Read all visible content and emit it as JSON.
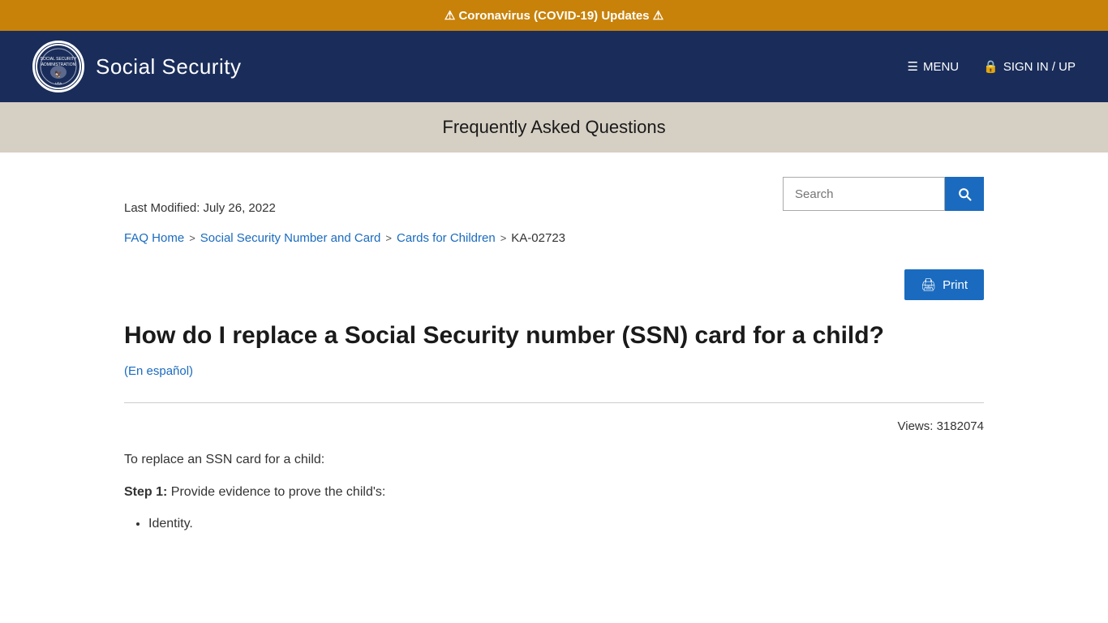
{
  "alert": {
    "text": "Coronavirus (COVID-19) Updates",
    "warning_symbol": "⚠"
  },
  "header": {
    "logo_alt": "Social Security Administration seal",
    "site_title": "Social Security",
    "nav": {
      "menu_label": "MENU",
      "signin_label": "SIGN IN / UP"
    }
  },
  "subtitle_bar": {
    "title": "Frequently Asked Questions"
  },
  "search": {
    "placeholder": "Search",
    "button_label": "Search"
  },
  "meta": {
    "last_modified": "Last Modified: July 26, 2022"
  },
  "breadcrumb": {
    "items": [
      {
        "label": "FAQ Home",
        "link": true
      },
      {
        "label": "Social Security Number and Card",
        "link": true
      },
      {
        "label": "Cards for Children",
        "link": true
      },
      {
        "label": "KA-02723",
        "link": false
      }
    ],
    "separator": ">"
  },
  "print": {
    "label": "Print"
  },
  "article": {
    "title": "How do I replace a Social Security number (SSN) card for a child?",
    "en_espanol": "(En español)",
    "views_label": "Views: 3182074",
    "intro": "To replace an SSN card for a child:",
    "step1_label": "Step 1:",
    "step1_text": " Provide evidence to prove the child's:",
    "step1_items": [
      "Identity."
    ]
  }
}
